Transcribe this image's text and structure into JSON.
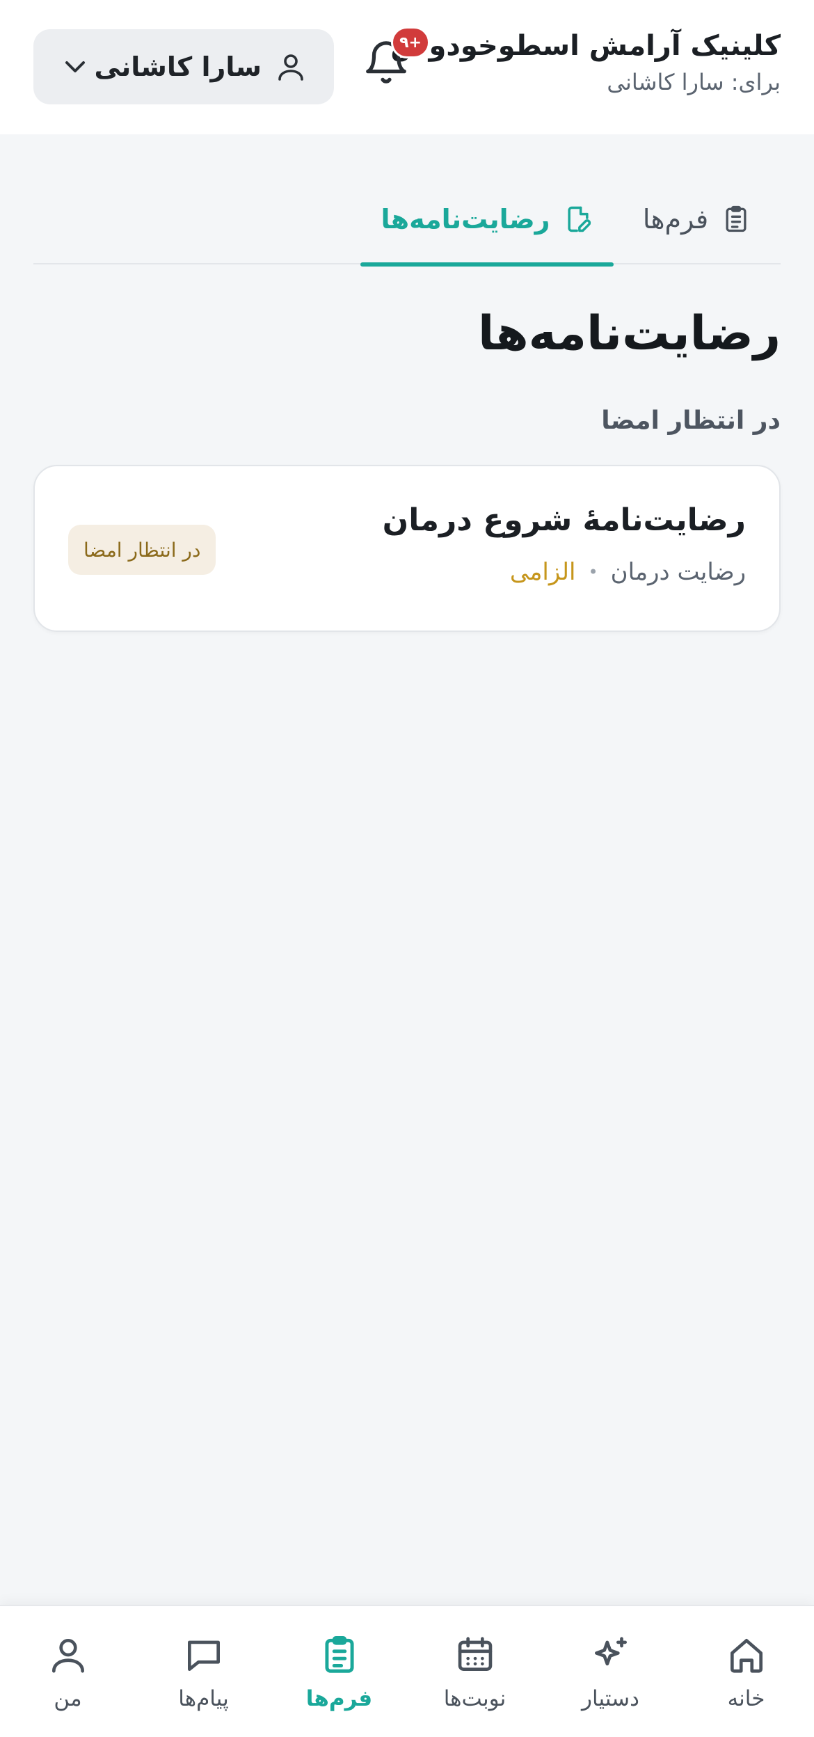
{
  "header": {
    "clinic_name": "کلینیک آرامش اسطوخودوس",
    "for_label": "برای: سارا کاشانی",
    "notification_badge": "۹+",
    "user_name": "سارا کاشانی"
  },
  "tabs": [
    {
      "label": "فرم‌ها",
      "icon": "clipboard-icon",
      "active": false
    },
    {
      "label": "رضایت‌نامه‌ها",
      "icon": "file-edit-icon",
      "active": true
    }
  ],
  "page_title": "رضایت‌نامه‌ها",
  "section_label": "در انتظار امضا",
  "card": {
    "title": "رضایت‌نامهٔ شروع درمان",
    "category": "رضایت درمان",
    "separator": "•",
    "required": "الزامی",
    "status": "در انتظار امضا"
  },
  "bottom_nav": [
    {
      "label": "خانه",
      "icon": "home-icon"
    },
    {
      "label": "دستیار",
      "icon": "sparkle-icon"
    },
    {
      "label": "نوبت‌ها",
      "icon": "calendar-icon"
    },
    {
      "label": "فرم‌ها",
      "icon": "clipboard-icon",
      "active": true
    },
    {
      "label": "پیام‌ها",
      "icon": "message-icon"
    },
    {
      "label": "من",
      "icon": "user-icon"
    }
  ],
  "colors": {
    "accent": "#1aa89a",
    "badge": "#d13b3b",
    "required": "#c6961c",
    "status_bg": "#f5eee3"
  }
}
